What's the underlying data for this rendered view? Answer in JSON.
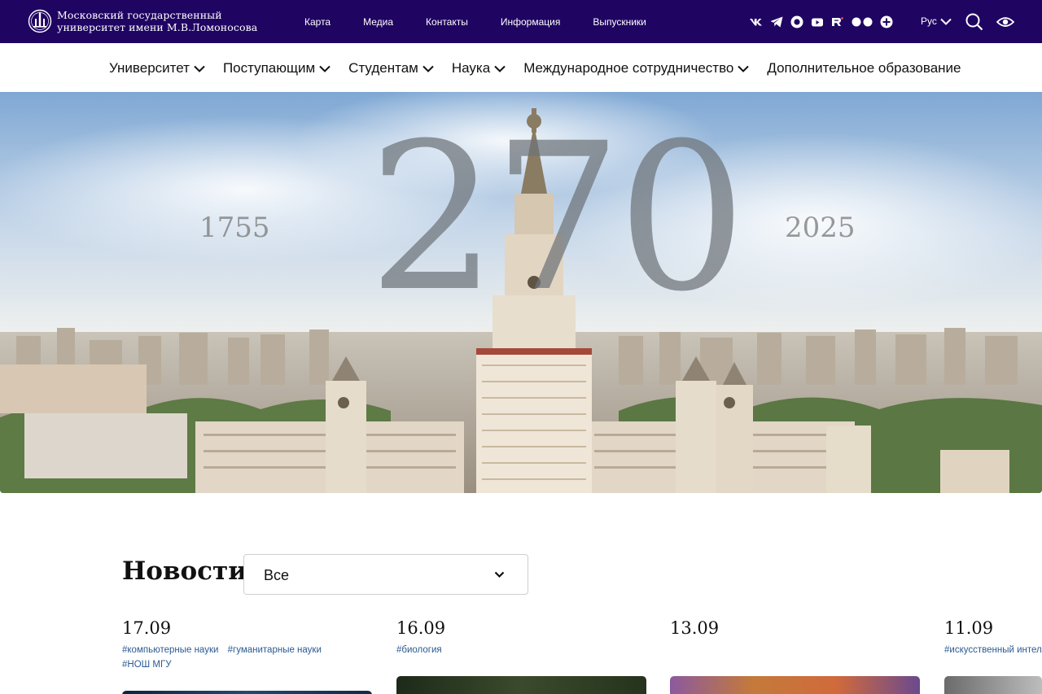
{
  "header": {
    "logo_line1": "Московский государственный",
    "logo_line2": "университет имени М.В.Ломоносова",
    "top_links": [
      "Карта",
      "Медиа",
      "Контакты",
      "Информация",
      "Выпускники"
    ],
    "social_icons": [
      "vk-icon",
      "telegram-icon",
      "max-icon",
      "youtube-icon",
      "rutube-icon",
      "dzen-icon",
      "plus-icon"
    ],
    "language": "Рус",
    "bg_color": "#1f0462"
  },
  "main_nav": {
    "items": [
      {
        "label": "Университет",
        "has_dropdown": true
      },
      {
        "label": "Поступающим",
        "has_dropdown": true
      },
      {
        "label": "Студентам",
        "has_dropdown": true
      },
      {
        "label": "Наука",
        "has_dropdown": true
      },
      {
        "label": "Международное сотрудничество",
        "has_dropdown": true
      },
      {
        "label": "Дополнительное образование",
        "has_dropdown": false
      }
    ]
  },
  "hero": {
    "year_start": "1755",
    "anniversary": "270",
    "year_end": "2025"
  },
  "news": {
    "title": "Новости",
    "filter_selected": "Все",
    "items": [
      {
        "date": "17.09",
        "tags": [
          "#компьютерные науки",
          "#гуманитарные науки",
          "#НОШ МГУ"
        ]
      },
      {
        "date": "16.09",
        "tags": [
          "#биология"
        ]
      },
      {
        "date": "13.09",
        "tags": []
      },
      {
        "date": "11.09",
        "tags": [
          "#искусственный интеллект"
        ]
      }
    ],
    "tag_color": "#2b5a91"
  }
}
